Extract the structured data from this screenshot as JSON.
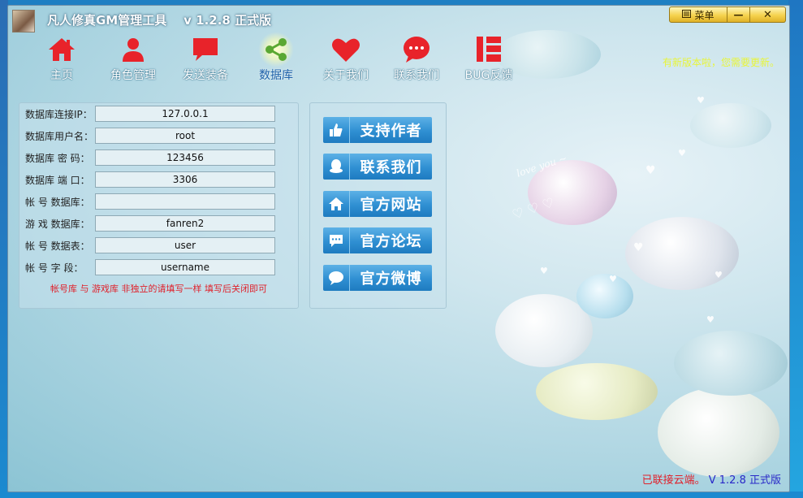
{
  "window": {
    "title": "凡人修真GM管理工具",
    "version": "v 1.2.8 正式版",
    "menu_label": "菜单",
    "minimize_label": "—",
    "close_label": "✕"
  },
  "nav": {
    "items": [
      {
        "label": "主页",
        "icon": "home-icon",
        "color": "#e8232a"
      },
      {
        "label": "角色管理",
        "icon": "user-icon",
        "color": "#e8232a"
      },
      {
        "label": "发送装备",
        "icon": "message-icon",
        "color": "#e8232a"
      },
      {
        "label": "数据库",
        "icon": "share-icon",
        "color": "#4a9a2a",
        "active": true
      },
      {
        "label": "关于我们",
        "icon": "heart-icon",
        "color": "#e8232a"
      },
      {
        "label": "联系我们",
        "icon": "chat-icon",
        "color": "#e8232a"
      },
      {
        "label": "BUG反馈",
        "icon": "bug-report-icon",
        "color": "#e8232a"
      }
    ]
  },
  "update_notice": "有新版本啦，您需要更新。",
  "db_form": {
    "fields": [
      {
        "label": "数据库连接IP：",
        "value": "127.0.0.1"
      },
      {
        "label": "数据库用户名：",
        "value": "root"
      },
      {
        "label": "数据库 密 码：",
        "value": "123456"
      },
      {
        "label": "数据库 端 口：",
        "value": "3306"
      },
      {
        "label": "帐 号 数据库：",
        "value": ""
      },
      {
        "label": "游 戏 数据库：",
        "value": "fanren2"
      },
      {
        "label": "帐 号 数据表：",
        "value": "user"
      },
      {
        "label": "帐 号  字 段：",
        "value": "username"
      }
    ],
    "note": "帐号库 与 游戏库 非独立的请填写一样 填写后关闭即可"
  },
  "actions": {
    "buttons": [
      {
        "label": "支持作者",
        "icon": "thumbs-up-icon"
      },
      {
        "label": "联系我们",
        "icon": "qq-icon"
      },
      {
        "label": "官方网站",
        "icon": "home-icon"
      },
      {
        "label": "官方论坛",
        "icon": "comment-icon"
      },
      {
        "label": "官方微博",
        "icon": "speech-bubble-icon"
      }
    ]
  },
  "status": {
    "connected": "已联接云端。",
    "version": "V 1.2.8 正式版"
  },
  "colors": {
    "accent_red": "#e8232a",
    "button_blue": "#2f8fd2",
    "notice_yellow": "#e8f53a"
  }
}
